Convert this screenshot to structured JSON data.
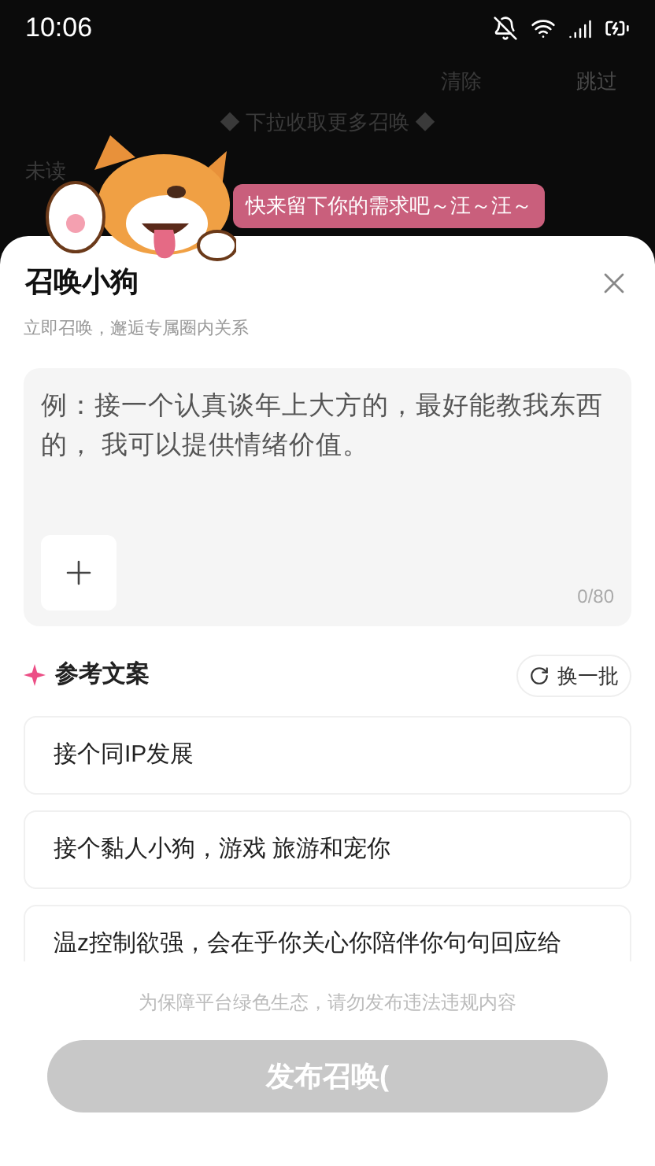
{
  "status_bar": {
    "time": "10:06"
  },
  "background": {
    "clear_label": "清除",
    "skip_label": "跳过",
    "pull_hint": "◆ 下拉收取更多召唤 ◆",
    "unread_label": "未读"
  },
  "mascot": {
    "speech": "快来留下你的需求吧～汪～汪～"
  },
  "sheet": {
    "title": "召唤小狗",
    "subtitle": "立即召唤，邂逅专属圈内关系",
    "input": {
      "placeholder": "例：接一个认真谈年上大方的，最好能教我东西的， 我可以提供情绪价值。",
      "counter": "0/80"
    },
    "reference": {
      "title": "参考文案",
      "refresh_label": "换一批",
      "items": [
        {
          "text": "接个同IP发展"
        },
        {
          "text": "接个黏人小狗，游戏 旅游和宠你"
        },
        {
          "text": "温z控制欲强，会在乎你关心你陪伴你句句回应给"
        }
      ]
    },
    "notice": "为保障平台绿色生态，请勿发布违法违规内容",
    "submit": {
      "label": "发布召唤(",
      "disabled": true
    }
  }
}
